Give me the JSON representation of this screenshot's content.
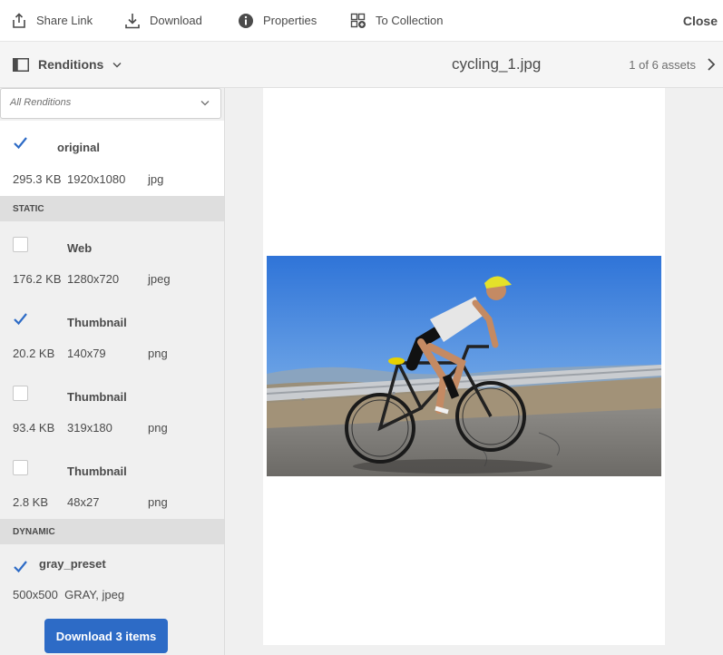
{
  "toolbar": {
    "share_link": "Share Link",
    "download": "Download",
    "properties": "Properties",
    "to_collection": "To Collection",
    "close": "Close"
  },
  "header": {
    "renditions_label": "Renditions",
    "asset_title": "cycling_1.jpg",
    "asset_count": "1 of 6 assets"
  },
  "panel": {
    "filter_placeholder": "All Renditions",
    "original": {
      "name": "original",
      "size": "295.3 KB",
      "dims": "1920x1080",
      "format": "jpg",
      "checked": true
    },
    "static_header": "STATIC",
    "static": [
      {
        "name": "Web",
        "size": "176.2 KB",
        "dims": "1280x720",
        "format": "jpeg",
        "checked": false
      },
      {
        "name": "Thumbnail",
        "size": "20.2 KB",
        "dims": "140x79",
        "format": "png",
        "checked": true
      },
      {
        "name": "Thumbnail",
        "size": "93.4 KB",
        "dims": "319x180",
        "format": "png",
        "checked": false
      },
      {
        "name": "Thumbnail",
        "size": "2.8 KB",
        "dims": "48x27",
        "format": "png",
        "checked": false
      }
    ],
    "dynamic_header": "DYNAMIC",
    "dynamic": [
      {
        "name": "gray_preset",
        "meta": "500x500  GRAY, jpeg",
        "checked": true
      }
    ],
    "download_button": "Download 3 items"
  },
  "colors": {
    "accent": "#2d6bc6",
    "check": "#2d6bc6",
    "section_bg": "#dedede"
  }
}
